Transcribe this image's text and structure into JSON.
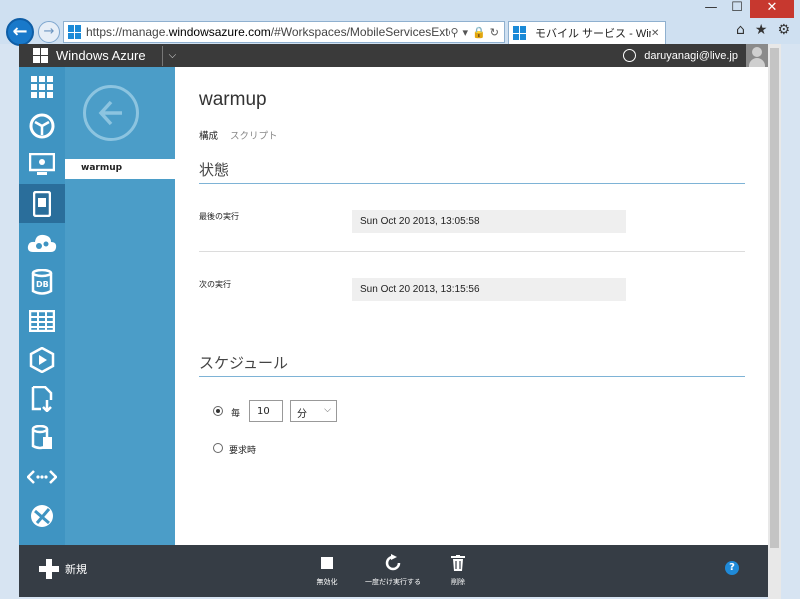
{
  "browser": {
    "url_prefix": "https://manage.",
    "url_domain": "windowsazure.com",
    "url_path": "/#Workspaces/MobileServicesExtension/apps",
    "tab_title": "モバイル サービス - Window...",
    "close_label": "✕",
    "minimize_label": "—",
    "maximize_label": "☐"
  },
  "azure": {
    "brand": "Windows Azure",
    "user": "daruyanagi@live.jp"
  },
  "sidebar": {
    "items": [
      {
        "name": "all-items",
        "icon": "grid-icon"
      },
      {
        "name": "websites",
        "icon": "globe-icon"
      },
      {
        "name": "virtual-machines",
        "icon": "monitor-icon"
      },
      {
        "name": "mobile-services",
        "icon": "phone-icon",
        "active": true
      },
      {
        "name": "cloud-services",
        "icon": "cloud-gear-icon"
      },
      {
        "name": "sql-databases",
        "icon": "database-icon"
      },
      {
        "name": "storage",
        "icon": "table-icon"
      },
      {
        "name": "media-services",
        "icon": "media-icon"
      },
      {
        "name": "import-export",
        "icon": "import-icon"
      },
      {
        "name": "hdinsight",
        "icon": "data-doc-icon"
      },
      {
        "name": "service-bus",
        "icon": "service-bus-icon"
      },
      {
        "name": "traffic-manager",
        "icon": "traffic-icon"
      }
    ]
  },
  "subnav": {
    "item": "warmup"
  },
  "main": {
    "title": "warmup",
    "tabs": [
      {
        "label": "構成",
        "active": true
      },
      {
        "label": "スクリプト",
        "active": false
      }
    ],
    "status_section": "状態",
    "last_run_label": "最後の実行",
    "last_run_value": "Sun Oct 20 2013, 13:05:58",
    "next_run_label": "次の実行",
    "next_run_value": "Sun Oct 20 2013, 13:15:56",
    "schedule_section": "スケジュール",
    "every_label": "毎",
    "interval_value": "10",
    "unit_value": "分",
    "on_demand_label": "要求時"
  },
  "commands": {
    "new_label": "新規",
    "disable_label": "無効化",
    "run_once_label": "一度だけ実行する",
    "delete_label": "削除",
    "help_label": "?"
  },
  "colors": {
    "nav_blue": "#3f94c2",
    "nav_active": "#2a6e9b",
    "subnav_blue": "#4b9dc8",
    "command_bar": "#363d45",
    "accent_rule": "#7eb3d6"
  }
}
